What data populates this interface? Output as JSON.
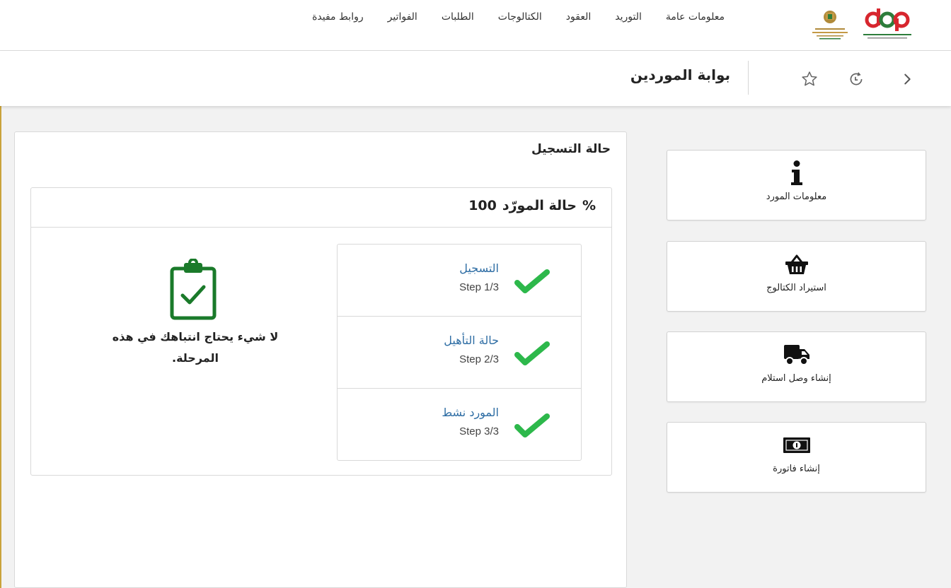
{
  "nav": {
    "items": [
      "معلومات عامة",
      "التوريد",
      "العقود",
      "الكتالوجات",
      "الطلبات",
      "الفواتير",
      "روابط مفيدة"
    ],
    "logo_dgp_text": "dgp"
  },
  "subbar": {
    "title": "بوابة الموردين",
    "icons": [
      "star-icon",
      "history-icon",
      "chevron-right-icon"
    ]
  },
  "panel": {
    "title": "حالة التسجيل",
    "status_header": {
      "percent_sign": "%",
      "label": "حالة المورّد",
      "value": "100"
    },
    "steps": [
      {
        "title": "التسجيل",
        "sub": "Step 1/3",
        "status": "complete"
      },
      {
        "title": "حالة التأهيل",
        "sub": "Step 2/3",
        "status": "complete"
      },
      {
        "title": "المورد نشط",
        "sub": "Step 3/3",
        "status": "complete"
      }
    ],
    "nothing_message": "لا شيء يحتاج انتباهك في هذه المرحلة."
  },
  "actions": [
    {
      "label": "معلومات المورد",
      "icon": "info-icon"
    },
    {
      "label": "استيراد الكتالوج",
      "icon": "basket-icon"
    },
    {
      "label": "إنشاء وصل استلام",
      "icon": "truck-icon"
    },
    {
      "label": "إنشاء فاتورة",
      "icon": "money-icon"
    }
  ],
  "colors": {
    "check_green": "#2db84b",
    "clipboard_green": "#1a7a2a",
    "link_blue": "#2e6da4",
    "frame_gold": "#c9a23b"
  }
}
